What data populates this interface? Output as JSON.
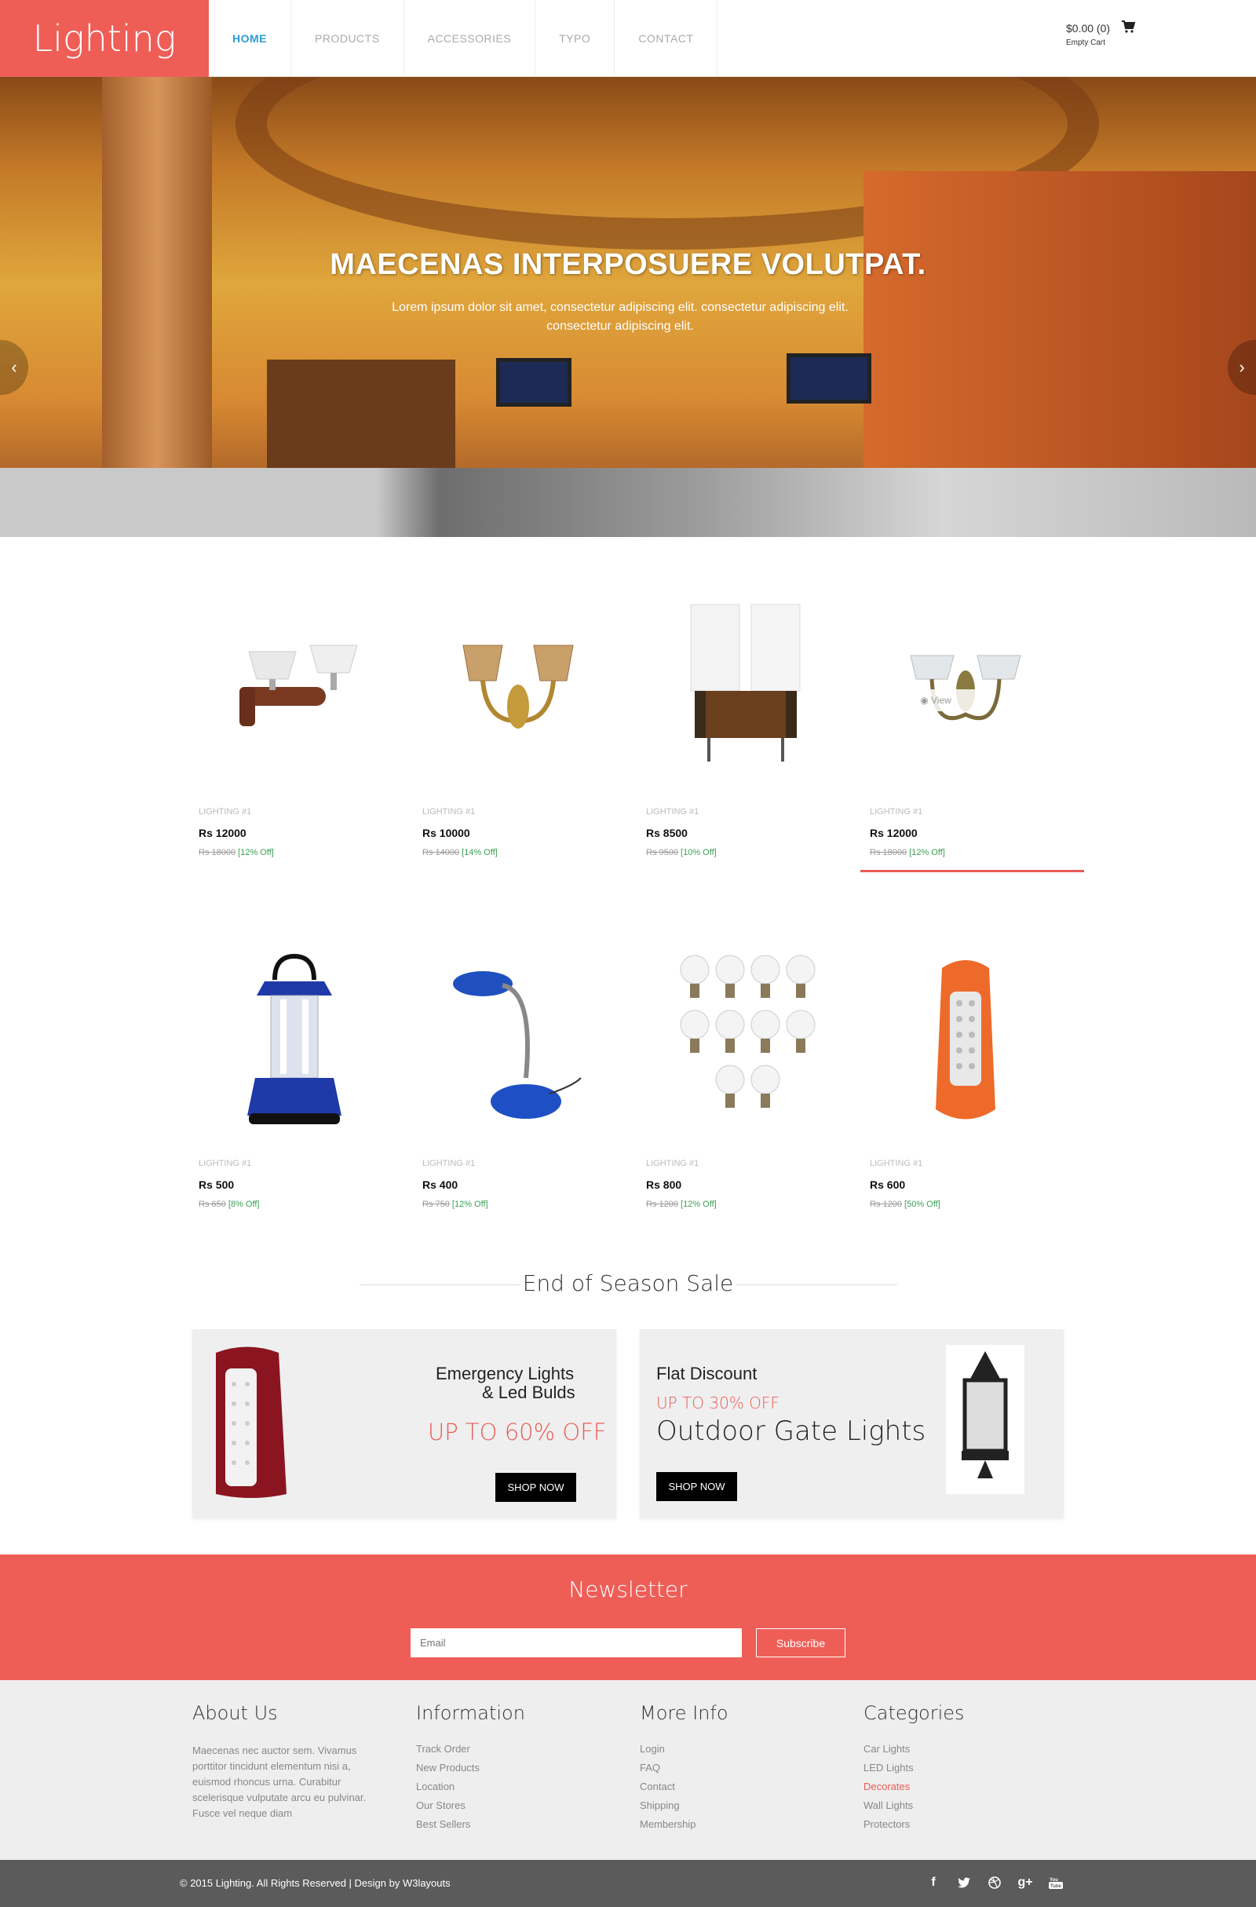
{
  "header": {
    "logo": "Lighting",
    "nav": [
      "HOME",
      "PRODUCTS",
      "ACCESSORIES",
      "TYPO",
      "CONTACT"
    ],
    "cart_amount": "$0.00 (0)",
    "cart_status": "Empty Cart"
  },
  "hero": {
    "title": "MAECENAS INTERPOSUERE VOLUTPAT.",
    "text": "Lorem ipsum dolor sit amet, consectetur adipiscing elit. consectetur adipiscing elit. consectetur adipiscing elit."
  },
  "products": [
    {
      "cat": "LIGHTING #1",
      "price": "Rs 12000",
      "old": "Rs 18000",
      "off": "[12% Off]",
      "icon": "wall-lamp-wood"
    },
    {
      "cat": "LIGHTING #1",
      "price": "Rs 10000",
      "old": "Rs 14000",
      "off": "[14% Off]",
      "icon": "wall-lamp-brass"
    },
    {
      "cat": "LIGHTING #1",
      "price": "Rs 8500",
      "old": "Rs 9500",
      "off": "[10% Off]",
      "icon": "wall-lamp-square"
    },
    {
      "cat": "LIGHTING #1",
      "price": "Rs 12000",
      "old": "Rs 18000",
      "off": "[12% Off]",
      "icon": "wall-lamp-glass",
      "view": "View"
    },
    {
      "cat": "LIGHTING #1",
      "price": "Rs 500",
      "old": "Rs 650",
      "off": "[8% Off]",
      "icon": "lantern"
    },
    {
      "cat": "LIGHTING #1",
      "price": "Rs 400",
      "old": "Rs 750",
      "off": "[12% Off]",
      "icon": "desk-lamp"
    },
    {
      "cat": "LIGHTING #1",
      "price": "Rs 800",
      "old": "Rs 1200",
      "off": "[12% Off]",
      "icon": "led-bulbs"
    },
    {
      "cat": "LIGHTING #1",
      "price": "Rs 600",
      "old": "Rs 1200",
      "off": "[50% Off]",
      "icon": "emergency-light"
    }
  ],
  "sale": {
    "title": "End of Season Sale",
    "banner1": {
      "line1": "Emergency Lights",
      "line2": "& Led Bulds",
      "offer": "UP TO 60% OFF",
      "button": "SHOP NOW"
    },
    "banner2": {
      "line1": "Flat Discount",
      "offer": "UP TO 30% OFF",
      "title": "Outdoor Gate Lights",
      "button": "SHOP NOW"
    }
  },
  "newsletter": {
    "title": "Newsletter",
    "placeholder": "Email",
    "button": "Subscribe"
  },
  "footer": {
    "about_title": "About Us",
    "about_text": "Maecenas nec auctor sem. Vivamus porttitor tincidunt elementum nisi a, euismod rhoncus urna. Curabitur scelerisque vulputate arcu eu pulvinar. Fusce vel neque diam",
    "info_title": "Information",
    "info": [
      "Track Order",
      "New Products",
      "Location",
      "Our Stores",
      "Best Sellers"
    ],
    "more_title": "More Info",
    "more": [
      "Login",
      "FAQ",
      "Contact",
      "Shipping",
      "Membership"
    ],
    "cat_title": "Categories",
    "cats": [
      "Car Lights",
      "LED Lights",
      "Decorates",
      "Wall Lights",
      "Protectors"
    ],
    "copyright": "© 2015 Lighting. All Rights Reserved | Design by W3layouts",
    "social": [
      "facebook-icon",
      "twitter-icon",
      "dribbble-icon",
      "google-plus-icon",
      "youtube-icon"
    ]
  },
  "colors": {
    "accent": "#ee5e57",
    "link": "#2a9bd6",
    "discount": "#3ba055"
  }
}
